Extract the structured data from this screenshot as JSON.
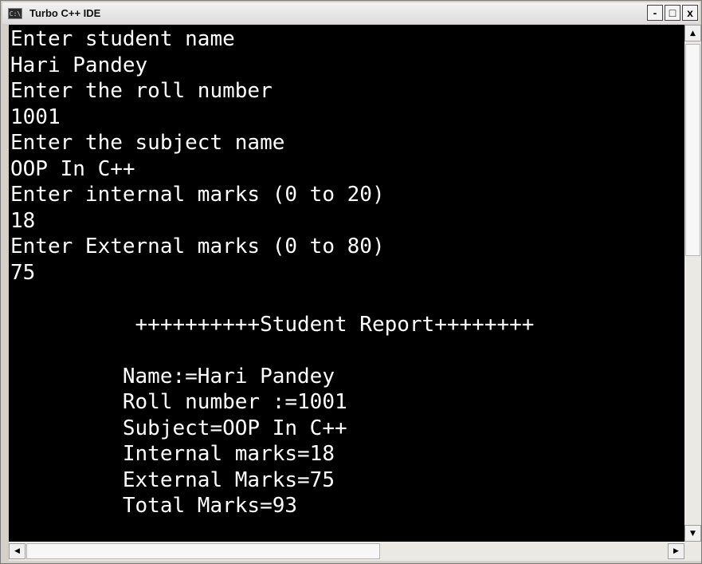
{
  "window": {
    "title": "Turbo C++ IDE",
    "app_icon_text": "C:\\",
    "minimize_glyph": "-",
    "maximize_glyph": "□",
    "close_glyph": "x"
  },
  "console": {
    "lines": [
      "Enter student name",
      "Hari Pandey",
      "Enter the roll number",
      "1001",
      "Enter the subject name",
      "OOP In C++",
      "Enter internal marks (0 to 20)",
      "18",
      "Enter External marks (0 to 80)",
      "75",
      "",
      "          ++++++++++Student Report++++++++",
      "",
      "         Name:=Hari Pandey",
      "         Roll number :=1001",
      "         Subject=OOP In C++",
      "         Internal marks=18",
      "         External Marks=75",
      "         Total Marks=93"
    ]
  },
  "scrollbars": {
    "up_arrow": "▲",
    "down_arrow": "▼",
    "left_arrow": "◀",
    "right_arrow": "▶"
  }
}
